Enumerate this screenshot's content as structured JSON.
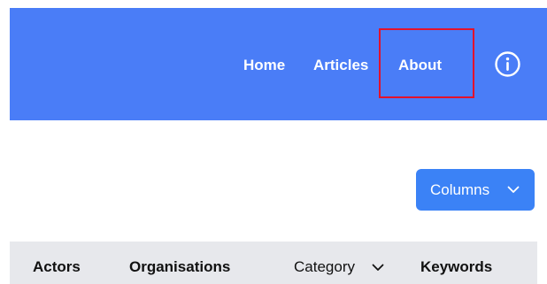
{
  "navbar": {
    "links": [
      {
        "label": "Home"
      },
      {
        "label": "Articles"
      },
      {
        "label": "About"
      }
    ],
    "info_icon": "info-circle-icon",
    "background_color": "#4a7df7",
    "highlight_color": "#e3122b"
  },
  "toolbar": {
    "columns_label": "Columns",
    "columns_icon": "chevron-down-icon",
    "button_color": "#3b82f6"
  },
  "table": {
    "headers": [
      {
        "label": "Actors"
      },
      {
        "label": "Organisations"
      },
      {
        "label": "Category",
        "icon": "chevron-down-icon"
      },
      {
        "label": "Keywords"
      }
    ],
    "header_background": "#e7e8ec"
  }
}
